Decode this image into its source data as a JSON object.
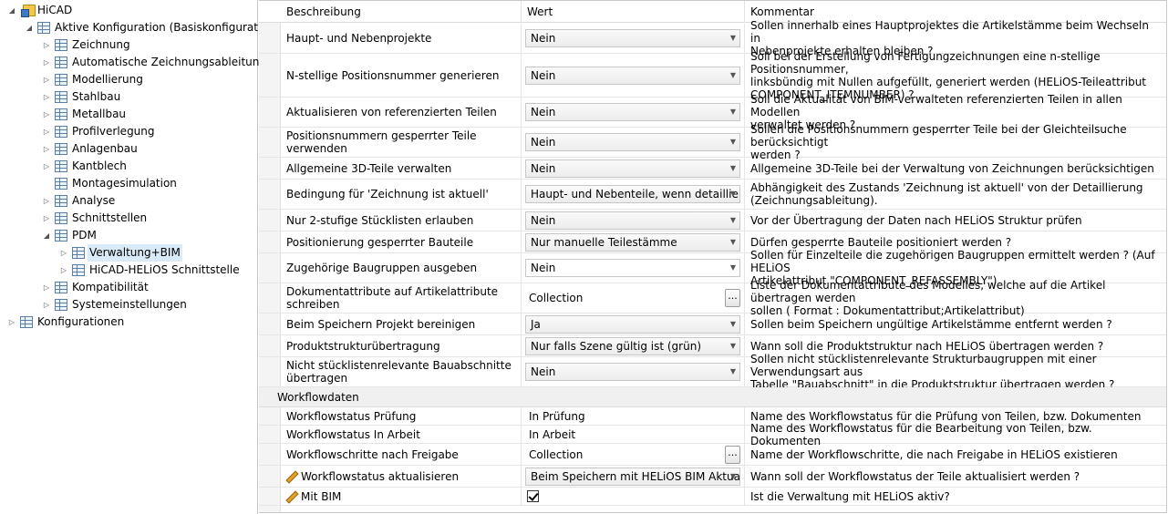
{
  "tree": {
    "nodes": [
      {
        "label": "HiCAD",
        "icon": "hicad-icon",
        "expander": "expanded"
      },
      {
        "label": "Aktive Konfiguration (Basiskonfiguration)",
        "icon": "config-icon",
        "expander": "expanded"
      },
      {
        "label": "Zeichnung",
        "icon": "config-icon",
        "expander": "collapsed"
      },
      {
        "label": "Automatische Zeichnungsableitung",
        "icon": "config-icon",
        "expander": "collapsed"
      },
      {
        "label": "Modellierung",
        "icon": "config-icon",
        "expander": "collapsed"
      },
      {
        "label": "Stahlbau",
        "icon": "config-icon",
        "expander": "collapsed"
      },
      {
        "label": "Metallbau",
        "icon": "config-icon",
        "expander": "collapsed"
      },
      {
        "label": "Profilverlegung",
        "icon": "config-icon",
        "expander": "collapsed"
      },
      {
        "label": "Anlagenbau",
        "icon": "config-icon",
        "expander": "collapsed"
      },
      {
        "label": "Kantblech",
        "icon": "config-icon",
        "expander": "collapsed"
      },
      {
        "label": "Montagesimulation",
        "icon": "config-icon",
        "expander": "none"
      },
      {
        "label": "Analyse",
        "icon": "config-icon",
        "expander": "collapsed"
      },
      {
        "label": "Schnittstellen",
        "icon": "config-icon",
        "expander": "collapsed"
      },
      {
        "label": "PDM",
        "icon": "config-icon",
        "expander": "expanded"
      },
      {
        "label": "Verwaltung+BIM",
        "icon": "config-icon",
        "expander": "collapsed",
        "selected": true
      },
      {
        "label": "HiCAD-HELiOS Schnittstelle",
        "icon": "config-icon",
        "expander": "collapsed"
      },
      {
        "label": "Kompatibilität",
        "icon": "config-icon",
        "expander": "collapsed"
      },
      {
        "label": "Systemeinstellungen",
        "icon": "config-icon",
        "expander": "collapsed"
      },
      {
        "label": "Konfigurationen",
        "icon": "config-icon",
        "expander": "collapsed"
      }
    ]
  },
  "grid": {
    "headers": {
      "description": "Beschreibung",
      "value": "Wert",
      "comment": "Kommentar"
    },
    "rows": [
      {
        "desc": [
          "Haupt- und Nebenprojekte"
        ],
        "value": "Nein",
        "kind": "combo",
        "comment": [
          "Sollen innerhalb eines Hauptprojektes die Artikelstämme beim Wechseln in",
          "Nebenprojekte erhalten bleiben ?"
        ]
      },
      {
        "desc": [
          "N-stellige Positionsnummer generieren"
        ],
        "value": "Nein",
        "kind": "combo",
        "comment": [
          "Soll bei der Erstellung von Fertigungzeichnungen eine n-stellige Positionsnummer,",
          "linksbündig mit Nullen aufgefüllt, generiert werden (HELiOS-Teileattribut",
          "COMPONENT_ITEMNUMBER) ?"
        ]
      },
      {
        "desc": [
          "Aktualisieren von referenzierten Teilen"
        ],
        "value": "Nein",
        "kind": "combo",
        "comment": [
          "Soll die Aktualität von  BIM-verwalteten referenzierten Teilen in allen Modellen",
          "verwaltet werden ?"
        ]
      },
      {
        "desc": [
          "Positionsnummern gesperrter Teile verwenden"
        ],
        "value": "Nein",
        "kind": "combo",
        "comment": [
          "Sollen die Positionsnummern gesperrter Teile bei der Gleichteilsuche berücksichtigt",
          "werden ?"
        ]
      },
      {
        "desc": [
          "Allgemeine 3D-Teile verwalten"
        ],
        "value": "Nein",
        "kind": "combo",
        "comment": [
          "Allgemeine 3D-Teile bei der Verwaltung von Zeichnungen berücksichtigen"
        ]
      },
      {
        "desc": [
          "Bedingung für 'Zeichnung ist aktuell'"
        ],
        "value": "Haupt- und Nebenteile, wenn detailliert",
        "kind": "combo",
        "comment": [
          "Abhängigkeit des Zustands 'Zeichnung ist aktuell' von der Detaillierung",
          "(Zeichnungsableitung)."
        ]
      },
      {
        "desc": [
          "Nur 2-stufige Stücklisten erlauben"
        ],
        "value": "Nein",
        "kind": "combo",
        "comment": [
          "Vor der Übertragung der Daten nach HELiOS Struktur prüfen"
        ]
      },
      {
        "desc": [
          "Positionierung gesperrter Bauteile"
        ],
        "value": "Nur manuelle Teilestämme",
        "kind": "combo",
        "comment": [
          "Dürfen gesperrte Bauteile positioniert werden ?"
        ]
      },
      {
        "desc": [
          "Zugehörige Baugruppen ausgeben"
        ],
        "value": "Nein",
        "kind": "combo-white",
        "comment": [
          "Sollen für Einzelteile die zugehörigen Baugruppen ermittelt werden ? (Auf HELiOS",
          "Artikelattribut \"COMPONENT_REFASSEMBLY\")"
        ]
      },
      {
        "desc": [
          "Dokumentattribute auf Artikelattribute",
          "schreiben"
        ],
        "value": "Collection",
        "kind": "collection",
        "comment": [
          "Liste der Dokumentattribute des Modelles, welche auf die Artikel übertragen werden",
          "sollen ( Format : Dokumentattribut;Artikelattribut)"
        ]
      },
      {
        "desc": [
          "Beim Speichern Projekt bereinigen"
        ],
        "value": "Ja",
        "kind": "combo",
        "comment": [
          "Sollen beim Speichern ungültige Artikelstämme entfernt werden ?"
        ]
      },
      {
        "desc": [
          "Produktstrukturübertragung"
        ],
        "value": "Nur falls Szene gültig ist (grün)",
        "kind": "combo",
        "comment": [
          "Wann soll die Produktstruktur nach HELiOS übertragen werden ?"
        ]
      },
      {
        "desc": [
          "Nicht stücklistenrelevante Bauabschnitte",
          "übertragen"
        ],
        "value": "Nein",
        "kind": "combo",
        "comment": [
          "Sollen nicht stücklistenrelevante Strukturbaugruppen mit einer Verwendungsart aus",
          "Tabelle \"Bauabschnitt\" in die Produktstruktur übertragen werden ?"
        ]
      }
    ],
    "section_label": "Workflowdaten",
    "workflow_rows": [
      {
        "desc": [
          "Workflowstatus Prüfung"
        ],
        "value": "In Prüfung",
        "kind": "text",
        "comment": [
          "Name des Workflowstatus für die Prüfung von Teilen, bzw. Dokumenten"
        ]
      },
      {
        "desc": [
          "Workflowstatus In Arbeit"
        ],
        "value": "In Arbeit",
        "kind": "text",
        "comment": [
          "Name des Workflowstatus für die Bearbeitung von Teilen, bzw. Dokumenten"
        ]
      },
      {
        "desc": [
          "Workflowschritte nach Freigabe"
        ],
        "value": "Collection",
        "kind": "collection",
        "comment": [
          "Name der Workflowschritte, die nach Freigabe in HELiOS existieren"
        ]
      },
      {
        "desc": [
          "Workflowstatus aktualisieren"
        ],
        "value": "Beim Speichern mit HELiOS BIM Aktualisierung",
        "kind": "combo",
        "pencil": true,
        "comment": [
          "Wann soll der Workflowstatus der Teile aktualisiert werden ?"
        ]
      },
      {
        "desc": [
          "Mit BIM"
        ],
        "value": "",
        "checked": true,
        "kind": "check",
        "pencil": true,
        "comment": [
          "Ist die Verwaltung mit HELiOS aktiv?"
        ]
      }
    ]
  }
}
